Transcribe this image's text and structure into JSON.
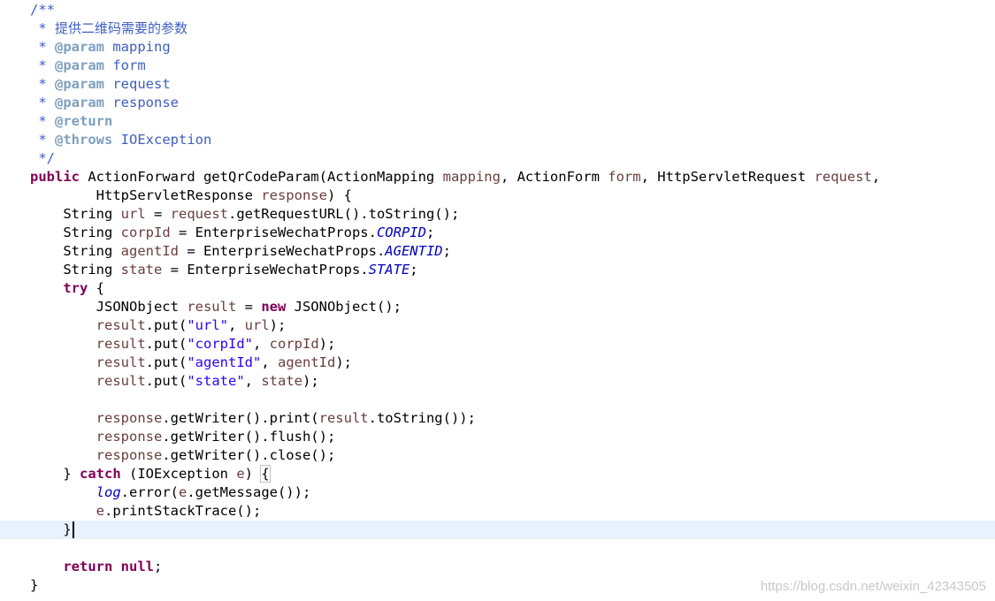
{
  "editor": {
    "lines": [
      [
        {
          "t": "/**",
          "c": "c-comment"
        }
      ],
      [
        {
          "t": " * ",
          "c": "c-comment"
        },
        {
          "t": "提供二维码需要的参数",
          "c": "c-javadoc-text cjk"
        }
      ],
      [
        {
          "t": " * ",
          "c": "c-comment"
        },
        {
          "t": "@param",
          "c": "c-javadoc-tag"
        },
        {
          "t": " mapping",
          "c": "c-javadoc-text"
        }
      ],
      [
        {
          "t": " * ",
          "c": "c-comment"
        },
        {
          "t": "@param",
          "c": "c-javadoc-tag"
        },
        {
          "t": " form",
          "c": "c-javadoc-text"
        }
      ],
      [
        {
          "t": " * ",
          "c": "c-comment"
        },
        {
          "t": "@param",
          "c": "c-javadoc-tag"
        },
        {
          "t": " request",
          "c": "c-javadoc-text"
        }
      ],
      [
        {
          "t": " * ",
          "c": "c-comment"
        },
        {
          "t": "@param",
          "c": "c-javadoc-tag"
        },
        {
          "t": " response",
          "c": "c-javadoc-text"
        }
      ],
      [
        {
          "t": " * ",
          "c": "c-comment"
        },
        {
          "t": "@return",
          "c": "c-javadoc-tag"
        }
      ],
      [
        {
          "t": " * ",
          "c": "c-comment"
        },
        {
          "t": "@throws",
          "c": "c-javadoc-tag"
        },
        {
          "t": " IOException",
          "c": "c-javadoc-text"
        }
      ],
      [
        {
          "t": " */",
          "c": "c-comment"
        }
      ],
      [
        {
          "t": "public",
          "c": "c-kw"
        },
        {
          "t": " ActionForward getQrCodeParam(ActionMapping ",
          "c": "c-plain"
        },
        {
          "t": "mapping",
          "c": "c-param"
        },
        {
          "t": ", ActionForm ",
          "c": "c-plain"
        },
        {
          "t": "form",
          "c": "c-param"
        },
        {
          "t": ", HttpServletRequest ",
          "c": "c-plain"
        },
        {
          "t": "request",
          "c": "c-param"
        },
        {
          "t": ",",
          "c": "c-plain"
        }
      ],
      [
        {
          "t": "        HttpServletResponse ",
          "c": "c-plain"
        },
        {
          "t": "response",
          "c": "c-param"
        },
        {
          "t": ") {",
          "c": "c-plain"
        }
      ],
      [
        {
          "t": "    String ",
          "c": "c-plain"
        },
        {
          "t": "url",
          "c": "c-local"
        },
        {
          "t": " = ",
          "c": "c-plain"
        },
        {
          "t": "request",
          "c": "c-param"
        },
        {
          "t": ".getRequestURL().toString();",
          "c": "c-plain"
        }
      ],
      [
        {
          "t": "    String ",
          "c": "c-plain"
        },
        {
          "t": "corpId",
          "c": "c-local"
        },
        {
          "t": " = EnterpriseWechatProps.",
          "c": "c-plain"
        },
        {
          "t": "CORPID",
          "c": "c-const"
        },
        {
          "t": ";",
          "c": "c-plain"
        }
      ],
      [
        {
          "t": "    String ",
          "c": "c-plain"
        },
        {
          "t": "agentId",
          "c": "c-local"
        },
        {
          "t": " = EnterpriseWechatProps.",
          "c": "c-plain"
        },
        {
          "t": "AGENTID",
          "c": "c-const"
        },
        {
          "t": ";",
          "c": "c-plain"
        }
      ],
      [
        {
          "t": "    String ",
          "c": "c-plain"
        },
        {
          "t": "state",
          "c": "c-local"
        },
        {
          "t": " = EnterpriseWechatProps.",
          "c": "c-plain"
        },
        {
          "t": "STATE",
          "c": "c-const"
        },
        {
          "t": ";",
          "c": "c-plain"
        }
      ],
      [
        {
          "t": "    ",
          "c": "c-plain"
        },
        {
          "t": "try",
          "c": "c-kw"
        },
        {
          "t": " {",
          "c": "c-plain"
        }
      ],
      [
        {
          "t": "        JSONObject ",
          "c": "c-plain"
        },
        {
          "t": "result",
          "c": "c-local"
        },
        {
          "t": " = ",
          "c": "c-plain"
        },
        {
          "t": "new",
          "c": "c-kw"
        },
        {
          "t": " JSONObject();",
          "c": "c-plain"
        }
      ],
      [
        {
          "t": "        ",
          "c": "c-plain"
        },
        {
          "t": "result",
          "c": "c-local"
        },
        {
          "t": ".put(",
          "c": "c-plain"
        },
        {
          "t": "\"url\"",
          "c": "c-string"
        },
        {
          "t": ", ",
          "c": "c-plain"
        },
        {
          "t": "url",
          "c": "c-local"
        },
        {
          "t": ");",
          "c": "c-plain"
        }
      ],
      [
        {
          "t": "        ",
          "c": "c-plain"
        },
        {
          "t": "result",
          "c": "c-local"
        },
        {
          "t": ".put(",
          "c": "c-plain"
        },
        {
          "t": "\"corpId\"",
          "c": "c-string"
        },
        {
          "t": ", ",
          "c": "c-plain"
        },
        {
          "t": "corpId",
          "c": "c-local"
        },
        {
          "t": ");",
          "c": "c-plain"
        }
      ],
      [
        {
          "t": "        ",
          "c": "c-plain"
        },
        {
          "t": "result",
          "c": "c-local"
        },
        {
          "t": ".put(",
          "c": "c-plain"
        },
        {
          "t": "\"agentId\"",
          "c": "c-string"
        },
        {
          "t": ", ",
          "c": "c-plain"
        },
        {
          "t": "agentId",
          "c": "c-local"
        },
        {
          "t": ");",
          "c": "c-plain"
        }
      ],
      [
        {
          "t": "        ",
          "c": "c-plain"
        },
        {
          "t": "result",
          "c": "c-local"
        },
        {
          "t": ".put(",
          "c": "c-plain"
        },
        {
          "t": "\"state\"",
          "c": "c-string"
        },
        {
          "t": ", ",
          "c": "c-plain"
        },
        {
          "t": "state",
          "c": "c-local"
        },
        {
          "t": ");",
          "c": "c-plain"
        }
      ],
      [
        {
          "t": "",
          "c": "c-plain"
        }
      ],
      [
        {
          "t": "        ",
          "c": "c-plain"
        },
        {
          "t": "response",
          "c": "c-param"
        },
        {
          "t": ".getWriter().print(",
          "c": "c-plain"
        },
        {
          "t": "result",
          "c": "c-local"
        },
        {
          "t": ".toString());",
          "c": "c-plain"
        }
      ],
      [
        {
          "t": "        ",
          "c": "c-plain"
        },
        {
          "t": "response",
          "c": "c-param"
        },
        {
          "t": ".getWriter().flush();",
          "c": "c-plain"
        }
      ],
      [
        {
          "t": "        ",
          "c": "c-plain"
        },
        {
          "t": "response",
          "c": "c-param"
        },
        {
          "t": ".getWriter().close();",
          "c": "c-plain"
        }
      ],
      [
        {
          "t": "    } ",
          "c": "c-plain"
        },
        {
          "t": "catch",
          "c": "c-kw"
        },
        {
          "t": " (IOException ",
          "c": "c-plain"
        },
        {
          "t": "e",
          "c": "c-local"
        },
        {
          "t": ") ",
          "c": "c-plain"
        },
        {
          "t": "{",
          "c": "c-plain brace-match"
        }
      ],
      [
        {
          "t": "        ",
          "c": "c-plain"
        },
        {
          "t": "log",
          "c": "c-field-static"
        },
        {
          "t": ".error(",
          "c": "c-plain"
        },
        {
          "t": "e",
          "c": "c-local"
        },
        {
          "t": ".getMessage());",
          "c": "c-plain"
        }
      ],
      [
        {
          "t": "        ",
          "c": "c-plain"
        },
        {
          "t": "e",
          "c": "c-local"
        },
        {
          "t": ".printStackTrace();",
          "c": "c-plain"
        }
      ],
      [
        {
          "t": "    }",
          "c": "c-plain"
        }
      ],
      [
        {
          "t": "",
          "c": "c-plain"
        }
      ],
      [
        {
          "t": "    ",
          "c": "c-plain"
        },
        {
          "t": "return",
          "c": "c-kw"
        },
        {
          "t": " ",
          "c": "c-plain"
        },
        {
          "t": "null",
          "c": "c-kw"
        },
        {
          "t": ";",
          "c": "c-plain"
        }
      ],
      [
        {
          "t": "}",
          "c": "c-plain"
        }
      ]
    ],
    "current_line": 28
  },
  "watermark": "https://blog.csdn.net/weixin_42343505"
}
